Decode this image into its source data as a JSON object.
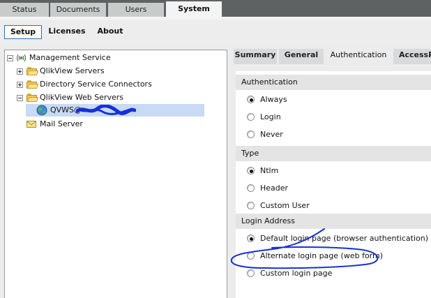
{
  "top_tabs": [
    {
      "label": "Status"
    },
    {
      "label": "Documents"
    },
    {
      "label": "Users"
    },
    {
      "label": "System"
    }
  ],
  "sub_tabs": [
    {
      "label": "Setup"
    },
    {
      "label": "Licenses"
    },
    {
      "label": "About"
    }
  ],
  "tree": {
    "root": "Management Service",
    "items": [
      {
        "label": "QlikView Servers"
      },
      {
        "label": "Directory Service Connectors"
      },
      {
        "label": "QlikView Web Servers"
      }
    ],
    "selected_node": "QVWS@",
    "mail": "Mail Server"
  },
  "right_tabs": [
    {
      "label": "Summary"
    },
    {
      "label": "General"
    },
    {
      "label": "Authentication"
    },
    {
      "label": "AccessP"
    }
  ],
  "sections": {
    "authentication": {
      "title": "Authentication",
      "options": [
        "Always",
        "Login",
        "Never"
      ],
      "selected": "Always"
    },
    "type": {
      "title": "Type",
      "options": [
        "Ntlm",
        "Header",
        "Custom User"
      ],
      "selected": "Ntlm"
    },
    "login_address": {
      "title": "Login Address",
      "options": [
        "Default login page (browser authentication)",
        "Alternate login page (web form)",
        "Custom login page"
      ],
      "selected": "Default login page (browser authentication)"
    }
  },
  "colors": {
    "top_bar": "#5e6263",
    "selection": "#c8daf4",
    "annotation_ink": "#1630d8"
  }
}
